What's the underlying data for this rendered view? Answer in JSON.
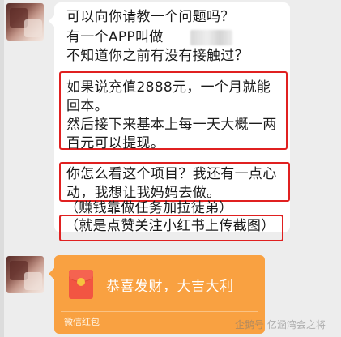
{
  "messages": {
    "lines": [
      "可以向你请教一个问题吗？",
      "有一个APP叫做",
      "不知道你之前有没有接触过？",
      "如果说充值2888元，一个月就能",
      "回本。",
      "然后接下来基本上每一天大概一两",
      "百元可以提现。",
      "你怎么看这个项目？我还有一点心",
      "动，我想让我妈妈去做。",
      "（赚钱靠做任务加拉徒弟）",
      "（就是点赞关注小红书上传截图"
    ],
    "last_line_end": "）"
  },
  "red_packet": {
    "greeting": "恭喜发财，大吉大利",
    "label": "微信红包",
    "color": "#f9a141"
  },
  "watermark": {
    "text": "企鹅号 亿涵湾会之将"
  },
  "colors": {
    "highlight_box": "#e02020",
    "chat_background": "#ededed"
  }
}
